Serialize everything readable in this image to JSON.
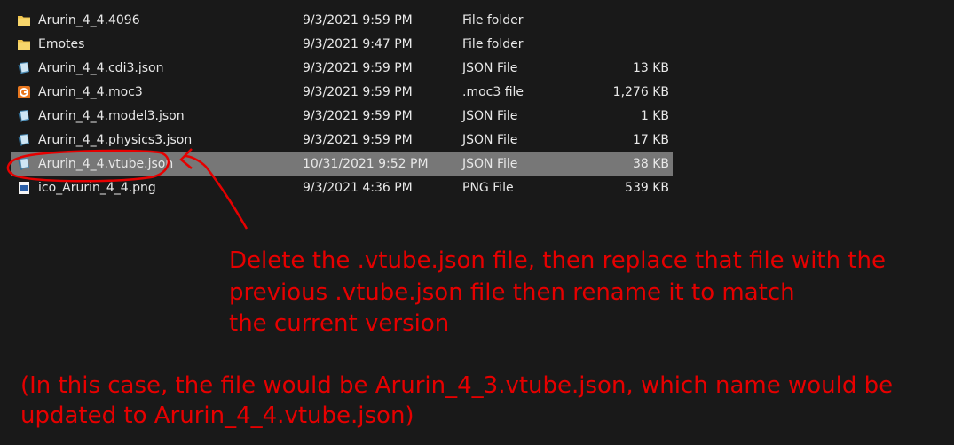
{
  "files": [
    {
      "name": "Arurin_4_4.4096",
      "date": "9/3/2021 9:59 PM",
      "type": "File folder",
      "size": "",
      "icon": "folder-icon",
      "selected": false
    },
    {
      "name": "Emotes",
      "date": "9/3/2021 9:47 PM",
      "type": "File folder",
      "size": "",
      "icon": "folder-icon",
      "selected": false
    },
    {
      "name": "Arurin_4_4.cdi3.json",
      "date": "9/3/2021 9:59 PM",
      "type": "JSON File",
      "size": "13 KB",
      "icon": "json-file-icon",
      "selected": false
    },
    {
      "name": "Arurin_4_4.moc3",
      "date": "9/3/2021 9:59 PM",
      "type": ".moc3 file",
      "size": "1,276 KB",
      "icon": "moc3-file-icon",
      "selected": false
    },
    {
      "name": "Arurin_4_4.model3.json",
      "date": "9/3/2021 9:59 PM",
      "type": "JSON File",
      "size": "1 KB",
      "icon": "json-file-icon",
      "selected": false
    },
    {
      "name": "Arurin_4_4.physics3.json",
      "date": "9/3/2021 9:59 PM",
      "type": "JSON File",
      "size": "17 KB",
      "icon": "json-file-icon",
      "selected": false
    },
    {
      "name": "Arurin_4_4.vtube.json",
      "date": "10/31/2021 9:52 PM",
      "type": "JSON File",
      "size": "38 KB",
      "icon": "json-file-icon",
      "selected": true
    },
    {
      "name": "ico_Arurin_4_4.png",
      "date": "9/3/2021 4:36 PM",
      "type": "PNG File",
      "size": "539 KB",
      "icon": "png-file-icon",
      "selected": false
    }
  ],
  "annotation": {
    "instruction_lines": [
      "Delete the .vtube.json file, then replace that file with the",
      "previous .vtube.json file then rename it to match",
      "the current version"
    ],
    "case_lines": [
      "(In this case, the file would be Arurin_4_3.vtube.json, which name would be",
      "updated to Arurin_4_4.vtube.json)"
    ]
  },
  "colors": {
    "background": "#191919",
    "text": "#e8e8e8",
    "selection": "#777777",
    "annotation": "#e60000",
    "folder": "#f0c44c",
    "moc3": "#e8771f"
  }
}
